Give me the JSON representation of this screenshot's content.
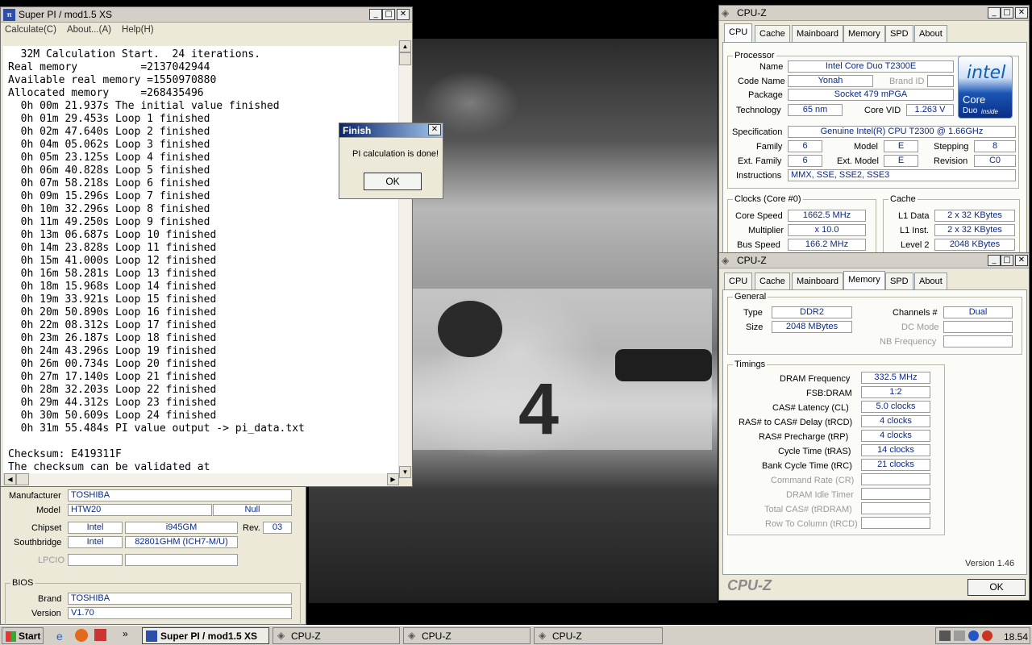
{
  "superpi": {
    "title": "Super PI / mod1.5 XS",
    "menu": [
      "Calculate(C)",
      "About...(A)",
      "Help(H)"
    ],
    "lines": [
      "  32M Calculation Start.  24 iterations.",
      "Real memory          =2137042944",
      "Available real memory =1550970880",
      "Allocated memory     =268435496",
      "  0h 00m 21.937s The initial value finished",
      "  0h 01m 29.453s Loop 1 finished",
      "  0h 02m 47.640s Loop 2 finished",
      "  0h 04m 05.062s Loop 3 finished",
      "  0h 05m 23.125s Loop 4 finished",
      "  0h 06m 40.828s Loop 5 finished",
      "  0h 07m 58.218s Loop 6 finished",
      "  0h 09m 15.296s Loop 7 finished",
      "  0h 10m 32.296s Loop 8 finished",
      "  0h 11m 49.250s Loop 9 finished",
      "  0h 13m 06.687s Loop 10 finished",
      "  0h 14m 23.828s Loop 11 finished",
      "  0h 15m 41.000s Loop 12 finished",
      "  0h 16m 58.281s Loop 13 finished",
      "  0h 18m 15.968s Loop 14 finished",
      "  0h 19m 33.921s Loop 15 finished",
      "  0h 20m 50.890s Loop 16 finished",
      "  0h 22m 08.312s Loop 17 finished",
      "  0h 23m 26.187s Loop 18 finished",
      "  0h 24m 43.296s Loop 19 finished",
      "  0h 26m 00.734s Loop 20 finished",
      "  0h 27m 17.140s Loop 21 finished",
      "  0h 28m 32.203s Loop 22 finished",
      "  0h 29m 44.312s Loop 23 finished",
      "  0h 30m 50.609s Loop 24 finished",
      "  0h 31m 55.484s PI value output -> pi_data.txt",
      "",
      "Checksum: E419311F",
      "The checksum can be validated at"
    ]
  },
  "finish": {
    "title": "Finish",
    "message": "PI calculation is done!",
    "ok": "OK"
  },
  "mainboard_back": {
    "manufacturer_label": "Manufacturer",
    "manufacturer": "TOSHIBA",
    "model_label": "Model",
    "model": "HTW20",
    "model_extra": "Null",
    "chipset_label": "Chipset",
    "chipset_vendor": "Intel",
    "chipset": "i945GM",
    "rev_label": "Rev.",
    "rev": "03",
    "southbridge_label": "Southbridge",
    "southbridge_vendor": "Intel",
    "southbridge": "82801GHM (ICH7-M/U)",
    "lpcio_label": "LPCIO",
    "bios_title": "BIOS",
    "brand_label": "Brand",
    "brand": "TOSHIBA",
    "version_label": "Version",
    "version": "V1.70"
  },
  "cpuz_cpu": {
    "title": "CPU-Z",
    "tabs": [
      "CPU",
      "Cache",
      "Mainboard",
      "Memory",
      "SPD",
      "About"
    ],
    "processor_title": "Processor",
    "name_label": "Name",
    "name": "Intel Core Duo T2300E",
    "codename_label": "Code Name",
    "codename": "Yonah",
    "brandid_label": "Brand ID",
    "package_label": "Package",
    "package": "Socket 479 mPGA",
    "technology_label": "Technology",
    "technology": "65 nm",
    "corevid_label": "Core VID",
    "corevid": "1.263 V",
    "spec_label": "Specification",
    "spec": "Genuine Intel(R) CPU         T2300  @ 1.66GHz",
    "family_label": "Family",
    "family": "6",
    "model_label": "Model",
    "model": "E",
    "stepping_label": "Stepping",
    "stepping": "8",
    "extfamily_label": "Ext. Family",
    "extfamily": "6",
    "extmodel_label": "Ext. Model",
    "extmodel": "E",
    "revision_label": "Revision",
    "revision": "C0",
    "instructions_label": "Instructions",
    "instructions": "MMX, SSE, SSE2, SSE3",
    "clocks_title": "Clocks (Core #0)",
    "corespeed_label": "Core Speed",
    "corespeed": "1662.5 MHz",
    "multiplier_label": "Multiplier",
    "multiplier": "x 10.0",
    "busspeed_label": "Bus Speed",
    "busspeed": "166.2 MHz",
    "cache_title": "Cache",
    "l1d_label": "L1 Data",
    "l1d": "2 x 32 KBytes",
    "l1i_label": "L1 Inst.",
    "l1i": "2 x 32 KBytes",
    "l2_label": "Level 2",
    "l2": "2048 KBytes",
    "logo_intel": "intel",
    "logo_core": "Core",
    "logo_duo": "Duo",
    "logo_inside": "inside"
  },
  "cpuz_mem": {
    "title": "CPU-Z",
    "tabs": [
      "CPU",
      "Cache",
      "Mainboard",
      "Memory",
      "SPD",
      "About"
    ],
    "general_title": "General",
    "type_label": "Type",
    "type": "DDR2",
    "size_label": "Size",
    "size": "2048 MBytes",
    "channels_label": "Channels #",
    "channels": "Dual",
    "dcmode_label": "DC Mode",
    "nbfreq_label": "NB Frequency",
    "timings_title": "Timings",
    "dram_label": "DRAM Frequency",
    "dram": "332.5 MHz",
    "fsb_label": "FSB:DRAM",
    "fsb": "1:2",
    "cas_label": "CAS# Latency (CL)",
    "cas": "5.0 clocks",
    "rcd_label": "RAS# to CAS# Delay (tRCD)",
    "rcd": "4 clocks",
    "rp_label": "RAS# Precharge (tRP)",
    "rp": "4 clocks",
    "ras_label": "Cycle Time (tRAS)",
    "ras": "14 clocks",
    "rc_label": "Bank Cycle Time (tRC)",
    "rc": "21 clocks",
    "cr_label": "Command Rate (CR)",
    "idle_label": "DRAM Idle Timer",
    "trdram_label": "Total CAS# (tRDRAM)",
    "rtc_label": "Row To Column (tRCD)",
    "version": "Version 1.46",
    "brand": "CPU-Z",
    "ok": "OK"
  },
  "taskbar": {
    "start": "Start",
    "tasks": [
      "Super PI / mod1.5 XS",
      "CPU-Z",
      "CPU-Z",
      "CPU-Z"
    ],
    "clock": "18.54"
  }
}
